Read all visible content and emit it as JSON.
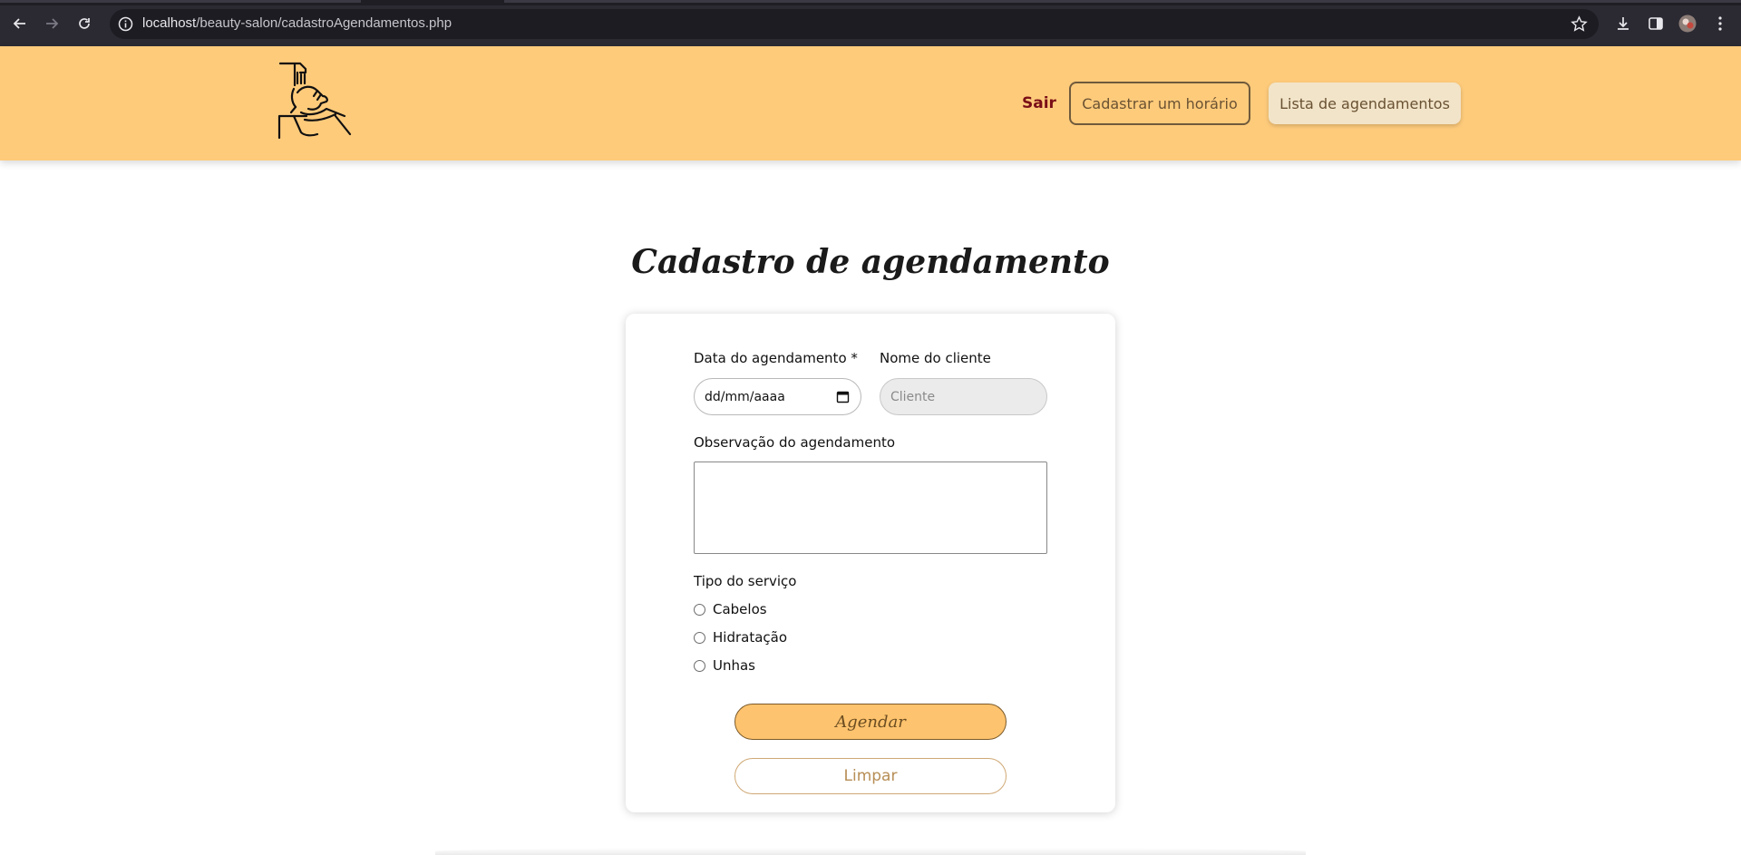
{
  "browser": {
    "url_host": "localhost",
    "url_path": "/beauty-salon/cadastroAgendamentos.php",
    "icons": [
      "back-arrow-icon",
      "forward-arrow-icon",
      "reload-icon",
      "info-icon",
      "star-icon",
      "download-icon",
      "sidebar-icon",
      "profile-avatar",
      "menu-dots-icon"
    ]
  },
  "header": {
    "logo": "salon-hair-wash-logo",
    "logout_label": "Sair",
    "register_slot_label": "Cadastrar um horário",
    "list_label": "Lista de agendamentos",
    "colors": {
      "background": "#fecb7b",
      "logout": "#7a0f17"
    }
  },
  "main": {
    "title": "Cadastro de agendamento",
    "form": {
      "date_label": "Data do agendamento *",
      "date_placeholder": "dd/mm/aaaa",
      "client_label": "Nome do cliente",
      "client_placeholder": "Cliente",
      "notes_label": "Observação do agendamento",
      "notes_value": "",
      "service_label": "Tipo do serviço",
      "services": [
        {
          "label": "Cabelos",
          "checked": false
        },
        {
          "label": "Hidratação",
          "checked": false
        },
        {
          "label": "Unhas",
          "checked": false
        }
      ],
      "submit_label": "Agendar",
      "reset_label": "Limpar",
      "colors": {
        "submit": "#fec36e",
        "reset_text": "#b78e55"
      }
    }
  }
}
